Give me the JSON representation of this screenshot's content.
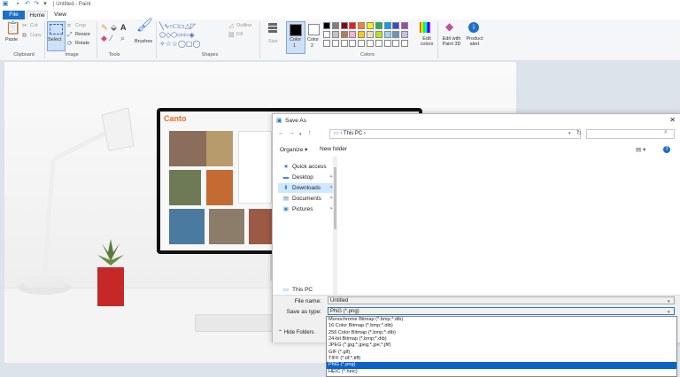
{
  "window": {
    "title": "| Untitled - Paint"
  },
  "menu": {
    "file": "File",
    "home": "Home",
    "view": "View"
  },
  "ribbon": {
    "paste": "Paste",
    "cut": "Cut",
    "copy": "Copy",
    "select": "Select",
    "crop": "Crop",
    "resize": "Resize",
    "rotate": "Rotate",
    "brushes": "Brushes",
    "outline": "Outline",
    "fill": "Fill",
    "size": "Size",
    "color1": "Color",
    "color1_num": "1",
    "color2": "Color",
    "color2_num": "2",
    "edit_colors": "Edit colors",
    "edit_paint3d": "Edit with Paint 3D",
    "product_alert": "Product alert",
    "groups": {
      "clipboard": "Clipboard",
      "image": "Image",
      "tools": "Tools",
      "shapes": "Shapes",
      "colors": "Colors"
    },
    "palette_row1": [
      "#000000",
      "#7f7f7f",
      "#880015",
      "#ed1c24",
      "#ff7f27",
      "#fff200",
      "#22b14c",
      "#00a2e8",
      "#3f48cc",
      "#a349a4"
    ],
    "palette_row2": [
      "#ffffff",
      "#c3c3c3",
      "#b97a57",
      "#ffaec9",
      "#ffc90e",
      "#efe4b0",
      "#b5e61d",
      "#99d9ea",
      "#7092be",
      "#c8bfe7"
    ]
  },
  "photo": {
    "screen_brand": "Canto"
  },
  "dialog": {
    "title": "Save As",
    "address": "This PC",
    "organize": "Organize ▾",
    "new_folder": "New folder",
    "nav": [
      "Quick access",
      "Desktop",
      "Downloads",
      "Documents",
      "Pictures"
    ],
    "this_pc": "This PC",
    "file_name_label": "File name:",
    "file_name_value": "Untitled",
    "save_type_label": "Save as type:",
    "save_type_value": "PNG (*.png)",
    "hide_folders": "Hide Folders"
  },
  "dropdown": {
    "options": [
      "Monochrome Bitmap (*.bmp;*.dib)",
      "16 Color Bitmap (*.bmp;*.dib)",
      "256 Color Bitmap (*.bmp;*.dib)",
      "24-bit Bitmap (*.bmp;*.dib)",
      "JPEG (*.jpg;*.jpeg;*.jpe;*.jfif)",
      "GIF (*.gif)",
      "TIFF (*.tif;*.tiff)",
      "PNG (*.png)",
      "HEIC (*.heic)"
    ],
    "selected": "PNG (*.png)"
  }
}
